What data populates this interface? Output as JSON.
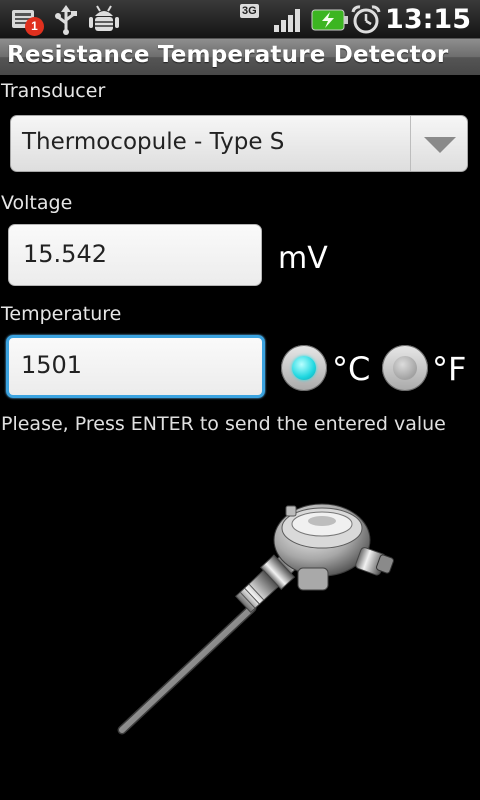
{
  "status_bar": {
    "notification_count": "1",
    "network_type": "3G",
    "time": "13:15",
    "icons": [
      "notification-icon",
      "usb-icon",
      "android-debug-icon",
      "signal-icon",
      "battery-charging-icon",
      "alarm-clock-icon"
    ]
  },
  "app": {
    "title": "Resistance Temperature Detector"
  },
  "transducer": {
    "label": "Transducer",
    "selected": "Thermocopule - Type S"
  },
  "voltage": {
    "label": "Voltage",
    "value": "15.542",
    "unit": "mV"
  },
  "temperature": {
    "label": "Temperature",
    "value": "1501",
    "units": [
      {
        "label": "°C",
        "selected": true
      },
      {
        "label": "°F",
        "selected": false
      }
    ]
  },
  "hint": "Please, Press ENTER to send the entered value",
  "colors": {
    "focus_border": "#3ba3e0",
    "radio_selected": "#1fd7e0",
    "notification_badge": "#e0301e",
    "battery": "#3cb521"
  }
}
